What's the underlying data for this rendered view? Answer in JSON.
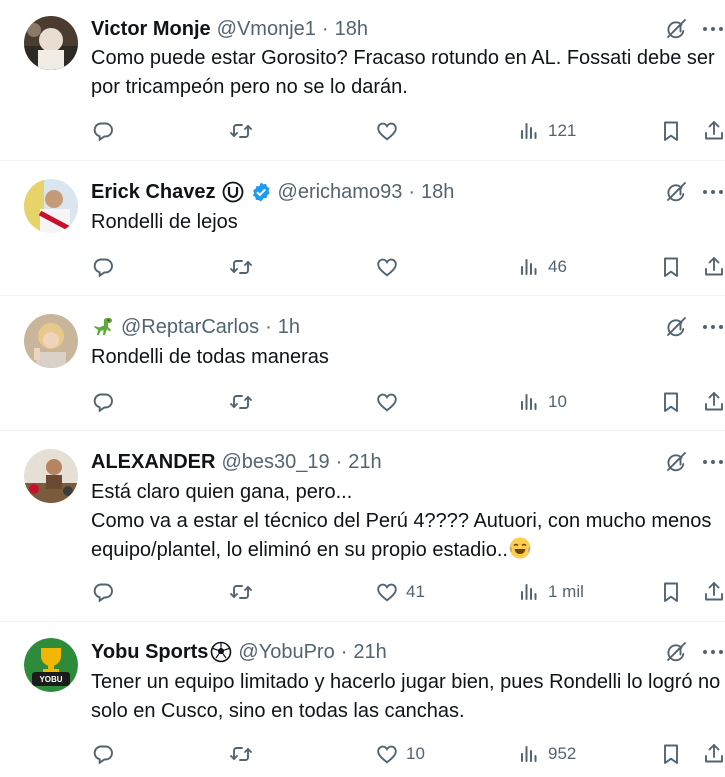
{
  "icons": {
    "reply": "reply-icon",
    "retweet": "retweet-icon",
    "like": "heart-icon",
    "views": "views-icon",
    "bookmark": "bookmark-icon",
    "share": "share-icon",
    "grok": "grok-icon",
    "more": "more-icon"
  },
  "colors": {
    "text": "#0f1419",
    "muted": "#536471",
    "verified": "#1d9bf0",
    "divider": "#eff3f4"
  },
  "tweets": [
    {
      "name": "Victor Monje",
      "handle": "@Vmonje1",
      "sep": "·",
      "time": "18h",
      "text": "Como puede estar Gorosito? Fracaso rotundo en AL. Fossati debe ser por tricampeón pero no se lo darán.",
      "replies": "",
      "retweets": "",
      "likes": "",
      "views": "121"
    },
    {
      "name": "Erick Chavez",
      "handle": "@erichamo93",
      "sep": "·",
      "time": "18h",
      "text": "Rondelli de lejos",
      "replies": "",
      "retweets": "",
      "likes": "",
      "views": "46"
    },
    {
      "name": "",
      "handle": "@ReptarCarlos",
      "sep": "·",
      "time": "1h",
      "text": "Rondelli de todas maneras",
      "replies": "",
      "retweets": "",
      "likes": "",
      "views": "10"
    },
    {
      "name": "ALEXANDER",
      "handle": "@bes30_19",
      "sep": "·",
      "time": "21h",
      "text": "Está claro quien gana, pero...\nComo va a estar el técnico del Perú 4???? Autuori, con mucho menos equipo/plantel, lo eliminó en su propio estadio..",
      "replies": "",
      "retweets": "",
      "likes": "41",
      "views": "1 mil"
    },
    {
      "name": "Yobu Sports",
      "handle": "@YobuPro",
      "sep": "·",
      "time": "21h",
      "text": "Tener un equipo limitado y hacerlo jugar bien, pues Rondelli lo logró no solo en Cusco, sino en todas las canchas.",
      "replies": "",
      "retweets": "",
      "likes": "10",
      "views": "952"
    }
  ]
}
